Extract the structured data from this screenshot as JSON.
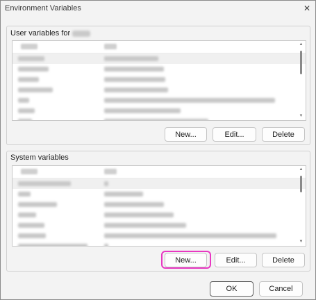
{
  "window": {
    "title": "Environment Variables",
    "close_glyph": "✕"
  },
  "user_group": {
    "label": "User variables for",
    "buttons": {
      "new": "New...",
      "edit": "Edit...",
      "delete": "Delete"
    }
  },
  "system_group": {
    "label": "System variables",
    "buttons": {
      "new": "New...",
      "edit": "Edit...",
      "delete": "Delete"
    }
  },
  "dialog_buttons": {
    "ok": "OK",
    "cancel": "Cancel"
  },
  "highlight_color": "#e838c2"
}
